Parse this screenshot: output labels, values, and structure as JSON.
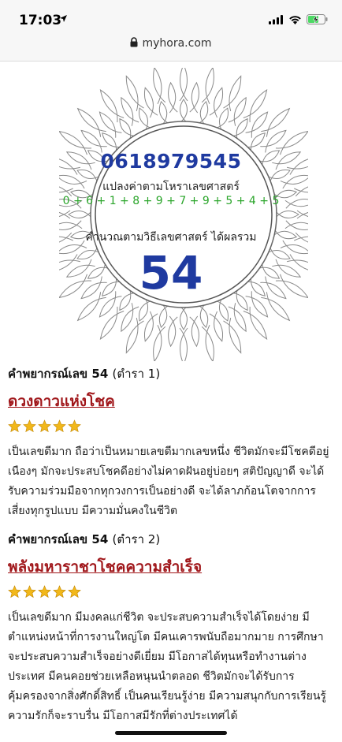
{
  "status_bar": {
    "time": "17:03",
    "location_icon": "location-arrow-icon",
    "signal_icon": "cellular-signal-icon",
    "wifi_icon": "wifi-icon",
    "battery_icon": "battery-charging-icon",
    "battery_color": "#4cd964"
  },
  "browser": {
    "url": "myhora.com",
    "lock_icon": "lock-icon"
  },
  "result": {
    "phone_number": "0618979545",
    "convert_label": "แปลงค่าตามโหราเลขศาสตร์",
    "digit_sum": "0 + 6 + 1 + 8 + 9 + 7 + 9 + 5 + 4 + 5",
    "calc_label": "คำนวณตามวิธีเลขศาสตร์ ได้ผลรวม",
    "total": "54",
    "frame_icon": "lotus-mandala-frame"
  },
  "colors": {
    "accent_blue": "#1f3aa0",
    "digit_green": "#2aa52a",
    "title_red": "#a0161a",
    "star_gold": "#f2b81a"
  },
  "predictions": [
    {
      "heading_prefix": "คำพยากรณ์เลข",
      "number": "54",
      "source": "(ตำรา 1)",
      "title": "ดวงดาวแห่งโชค",
      "rating": 5,
      "rating_max": 5,
      "body": "เป็นเลขดีมาก ถือว่าเป็นหมายเลขดีมากเลขหนึ่ง ชีวิตมักจะมีโชคดีอยู่เนืองๆ มักจะประสบโชคดีอย่างไม่คาดฝันอยู่บ่อยๆ สติปัญญาดี จะได้รับความร่วมมือจากทุกวงการเป็นอย่างดี จะได้ลาภก้อนโตจากการเสี่ยงทุกรูปแบบ มีความมั่นคงในชีวิต"
    },
    {
      "heading_prefix": "คำพยากรณ์เลข",
      "number": "54",
      "source": "(ตำรา 2)",
      "title": "พลังมหาราชาโชคความสำเร็จ",
      "rating": 5,
      "rating_max": 5,
      "body": "เป็นเลขดีมาก มีมงคลแก่ชีวิต จะประสบความสำเร็จได้โดยง่าย มีตำแหน่งหน้าที่การงานใหญ่โต มีคนเคารพนับถือมากมาย การศึกษาจะประสบความสำเร็จอย่างดีเยี่ยม มีโอกาสได้ทุนหรือทำงานต่างประเทศ มีคนคอยช่วยเหลือหนุนนำตลอด ชีวิตมักจะได้รับการคุ้มครองจากสิ่งศักดิ์สิทธิ์ เป็นคนเรียนรู้ง่าย มีความสนุกกับการเรียนรู้ ความรักก็จะราบรื่น มีโอกาสมีรักที่ต่างประเทศได้"
    }
  ]
}
